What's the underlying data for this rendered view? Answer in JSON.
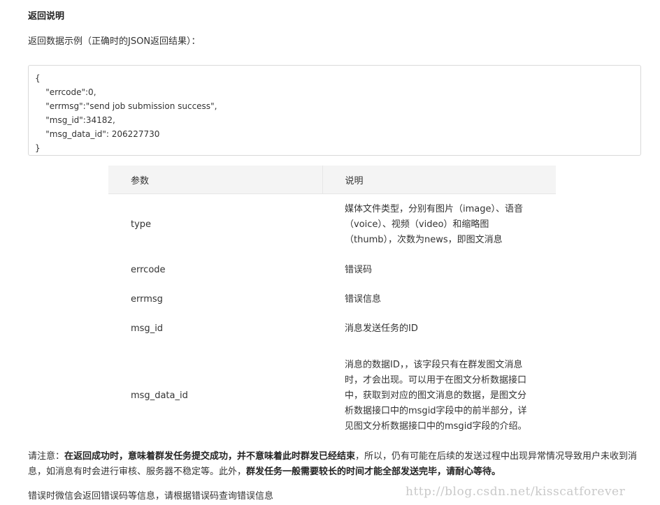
{
  "heading": "返回说明",
  "intro": "返回数据示例（正确时的JSON返回结果）：",
  "code_lines": [
    "{",
    "    \"errcode\":0,",
    "    \"errmsg\":\"send job submission success\",",
    "    \"msg_id\":34182,",
    "    \"msg_data_id\": 206227730",
    "}"
  ],
  "table": {
    "headers": [
      "参数",
      "说明"
    ],
    "rows": [
      {
        "name": "type",
        "desc": "媒体文件类型，分别有图片（image）、语音（voice）、视频（video）和缩略图（thumb），次数为news，即图文消息"
      },
      {
        "name": "errcode",
        "desc": "错误码"
      },
      {
        "name": "errmsg",
        "desc": "错误信息"
      },
      {
        "name": "msg_id",
        "desc": "消息发送任务的ID"
      },
      {
        "name": "msg_data_id",
        "desc": "消息的数据ID，，该字段只有在群发图文消息时，才会出现。可以用于在图文分析数据接口中，获取到对应的图文消息的数据，是图文分析数据接口中的msgid字段中的前半部分，详见图文分析数据接口中的msgid字段的介绍。"
      }
    ]
  },
  "notice": {
    "p1": "请注意：",
    "b1": "在返回成功时，意味着群发任务提交成功，并不意味着此时群发已经结束",
    "p2": "，所以，仍有可能在后续的发送过程中出现异常情况导致用户未收到消息，如消息有时会进行审核、服务器不稳定等。此外，",
    "b2": "群发任务一般需要较长的时间才能全部发送完毕，请耐心等待。"
  },
  "footer": "错误时微信会返回错误码等信息，请根据错误码查询错误信息",
  "watermark": "http://blog.csdn.net/kisscatforever"
}
